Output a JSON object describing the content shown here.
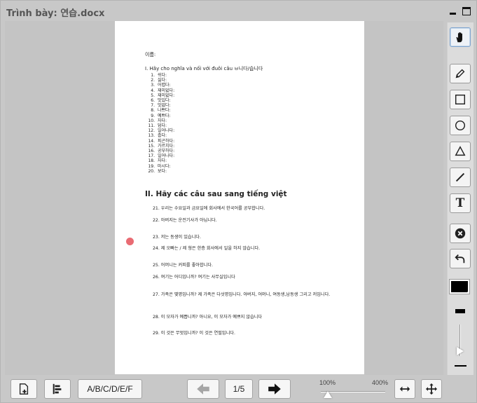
{
  "window": {
    "title": "Trình bày: 연습.docx"
  },
  "document": {
    "name_label": "이름:",
    "section1_heading": "I. Hãy cho nghĩa và nối với đuôi câu ㅂ니다/습니다",
    "words": [
      "쉬다:",
      "싫다:",
      "어렵다:",
      "재미없다:",
      "재미없다:",
      "맛있다:",
      "맛없다:",
      "나쁘다:",
      "예쁘다:",
      "자다:",
      "덥다:",
      "일어나다:",
      "춥다:",
      "피곤하다:",
      "가르치다:",
      "공부하다:",
      "일어나다:",
      "자다:",
      "마시다:",
      "보다:"
    ],
    "section2_heading": "II. Hãy các câu sau sang tiếng việt",
    "sentences": [
      "21. 우리는 수요일과 금요일에 회사에서 한국어를 공부합니다.",
      "22. 아버지는 운전기사가 아닙니다.",
      "23. 저는 동생이 있습니다.",
      "24. 제 오빠는 / 제 형은 한층 회사에서 일을 하지 않습니다.",
      "25. 어머니는 커피를 좋아합니다.",
      "26. 여기는 어디입니까? 여기는 사무실입니다",
      "27. 가족은 몇명입니까? 제 가족은 다섯명입니다. 아버지, 어머니, 여동생,남동생 그리고 저입니다.",
      "28. 이 모자가 예쁩니까? 아니요, 이 모자가 예쁘지 않습니다",
      "29. 이 것은 무엇입니까? 이 것은 연필입니다."
    ]
  },
  "toolbar_icons": [
    "hand-icon",
    "pencil-icon",
    "rectangle-icon",
    "circle-icon",
    "triangle-icon",
    "line-icon",
    "text-icon",
    "clear-icon",
    "undo-icon"
  ],
  "text_tool_label": "T",
  "pen_color": "#000000",
  "bottom": {
    "answer_label": "A/B/C/D/E/F",
    "page_indicator": "1/5",
    "zoom_min": "100%",
    "zoom_max": "400%",
    "zoom_fraction": 0
  },
  "colors": {
    "accent": "#7fa5cf",
    "laser": "#e96b73"
  }
}
